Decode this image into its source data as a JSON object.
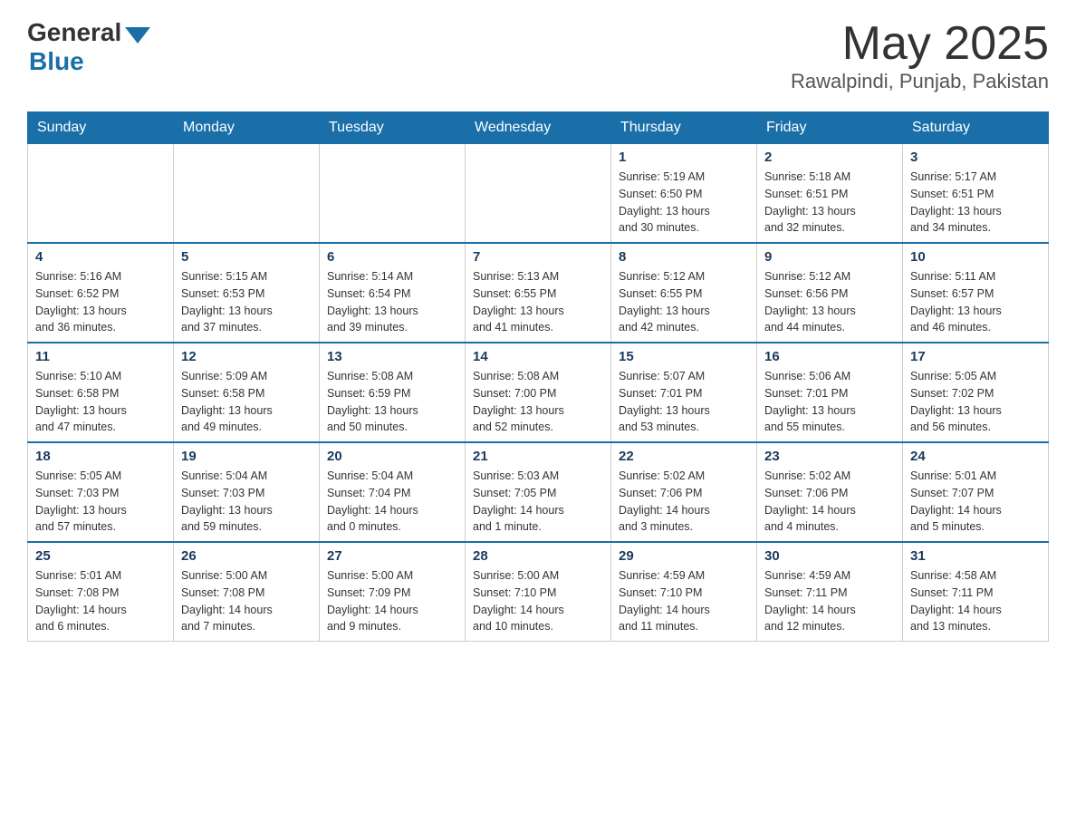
{
  "header": {
    "title": "May 2025",
    "location": "Rawalpindi, Punjab, Pakistan",
    "logo_general": "General",
    "logo_blue": "Blue"
  },
  "weekdays": [
    "Sunday",
    "Monday",
    "Tuesday",
    "Wednesday",
    "Thursday",
    "Friday",
    "Saturday"
  ],
  "weeks": [
    [
      {
        "day": "",
        "info": ""
      },
      {
        "day": "",
        "info": ""
      },
      {
        "day": "",
        "info": ""
      },
      {
        "day": "",
        "info": ""
      },
      {
        "day": "1",
        "info": "Sunrise: 5:19 AM\nSunset: 6:50 PM\nDaylight: 13 hours\nand 30 minutes."
      },
      {
        "day": "2",
        "info": "Sunrise: 5:18 AM\nSunset: 6:51 PM\nDaylight: 13 hours\nand 32 minutes."
      },
      {
        "day": "3",
        "info": "Sunrise: 5:17 AM\nSunset: 6:51 PM\nDaylight: 13 hours\nand 34 minutes."
      }
    ],
    [
      {
        "day": "4",
        "info": "Sunrise: 5:16 AM\nSunset: 6:52 PM\nDaylight: 13 hours\nand 36 minutes."
      },
      {
        "day": "5",
        "info": "Sunrise: 5:15 AM\nSunset: 6:53 PM\nDaylight: 13 hours\nand 37 minutes."
      },
      {
        "day": "6",
        "info": "Sunrise: 5:14 AM\nSunset: 6:54 PM\nDaylight: 13 hours\nand 39 minutes."
      },
      {
        "day": "7",
        "info": "Sunrise: 5:13 AM\nSunset: 6:55 PM\nDaylight: 13 hours\nand 41 minutes."
      },
      {
        "day": "8",
        "info": "Sunrise: 5:12 AM\nSunset: 6:55 PM\nDaylight: 13 hours\nand 42 minutes."
      },
      {
        "day": "9",
        "info": "Sunrise: 5:12 AM\nSunset: 6:56 PM\nDaylight: 13 hours\nand 44 minutes."
      },
      {
        "day": "10",
        "info": "Sunrise: 5:11 AM\nSunset: 6:57 PM\nDaylight: 13 hours\nand 46 minutes."
      }
    ],
    [
      {
        "day": "11",
        "info": "Sunrise: 5:10 AM\nSunset: 6:58 PM\nDaylight: 13 hours\nand 47 minutes."
      },
      {
        "day": "12",
        "info": "Sunrise: 5:09 AM\nSunset: 6:58 PM\nDaylight: 13 hours\nand 49 minutes."
      },
      {
        "day": "13",
        "info": "Sunrise: 5:08 AM\nSunset: 6:59 PM\nDaylight: 13 hours\nand 50 minutes."
      },
      {
        "day": "14",
        "info": "Sunrise: 5:08 AM\nSunset: 7:00 PM\nDaylight: 13 hours\nand 52 minutes."
      },
      {
        "day": "15",
        "info": "Sunrise: 5:07 AM\nSunset: 7:01 PM\nDaylight: 13 hours\nand 53 minutes."
      },
      {
        "day": "16",
        "info": "Sunrise: 5:06 AM\nSunset: 7:01 PM\nDaylight: 13 hours\nand 55 minutes."
      },
      {
        "day": "17",
        "info": "Sunrise: 5:05 AM\nSunset: 7:02 PM\nDaylight: 13 hours\nand 56 minutes."
      }
    ],
    [
      {
        "day": "18",
        "info": "Sunrise: 5:05 AM\nSunset: 7:03 PM\nDaylight: 13 hours\nand 57 minutes."
      },
      {
        "day": "19",
        "info": "Sunrise: 5:04 AM\nSunset: 7:03 PM\nDaylight: 13 hours\nand 59 minutes."
      },
      {
        "day": "20",
        "info": "Sunrise: 5:04 AM\nSunset: 7:04 PM\nDaylight: 14 hours\nand 0 minutes."
      },
      {
        "day": "21",
        "info": "Sunrise: 5:03 AM\nSunset: 7:05 PM\nDaylight: 14 hours\nand 1 minute."
      },
      {
        "day": "22",
        "info": "Sunrise: 5:02 AM\nSunset: 7:06 PM\nDaylight: 14 hours\nand 3 minutes."
      },
      {
        "day": "23",
        "info": "Sunrise: 5:02 AM\nSunset: 7:06 PM\nDaylight: 14 hours\nand 4 minutes."
      },
      {
        "day": "24",
        "info": "Sunrise: 5:01 AM\nSunset: 7:07 PM\nDaylight: 14 hours\nand 5 minutes."
      }
    ],
    [
      {
        "day": "25",
        "info": "Sunrise: 5:01 AM\nSunset: 7:08 PM\nDaylight: 14 hours\nand 6 minutes."
      },
      {
        "day": "26",
        "info": "Sunrise: 5:00 AM\nSunset: 7:08 PM\nDaylight: 14 hours\nand 7 minutes."
      },
      {
        "day": "27",
        "info": "Sunrise: 5:00 AM\nSunset: 7:09 PM\nDaylight: 14 hours\nand 9 minutes."
      },
      {
        "day": "28",
        "info": "Sunrise: 5:00 AM\nSunset: 7:10 PM\nDaylight: 14 hours\nand 10 minutes."
      },
      {
        "day": "29",
        "info": "Sunrise: 4:59 AM\nSunset: 7:10 PM\nDaylight: 14 hours\nand 11 minutes."
      },
      {
        "day": "30",
        "info": "Sunrise: 4:59 AM\nSunset: 7:11 PM\nDaylight: 14 hours\nand 12 minutes."
      },
      {
        "day": "31",
        "info": "Sunrise: 4:58 AM\nSunset: 7:11 PM\nDaylight: 14 hours\nand 13 minutes."
      }
    ]
  ]
}
